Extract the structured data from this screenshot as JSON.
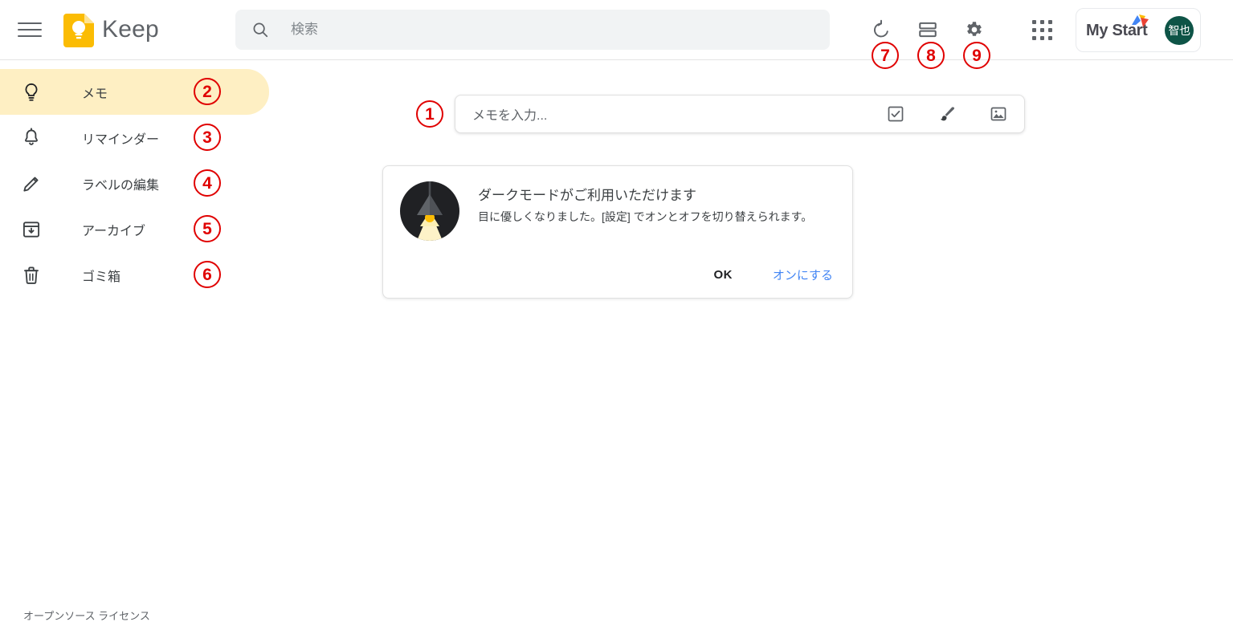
{
  "app": {
    "name": "Keep",
    "logo_icon": "keep-note-bulb-icon",
    "footer_link": "オープンソース ライセンス"
  },
  "header": {
    "menu_icon": "hamburger-menu-icon",
    "search": {
      "icon": "search-icon",
      "placeholder": "検索",
      "value": ""
    },
    "actions": [
      {
        "name": "refresh-button",
        "icon": "refresh-icon",
        "badge": "7"
      },
      {
        "name": "list-view-button",
        "icon": "list-view-icon",
        "badge": "8"
      },
      {
        "name": "settings-button",
        "icon": "gear-icon",
        "badge": "9"
      }
    ],
    "apps_icon": "apps-grid-icon",
    "account": {
      "brand": "My Start",
      "brand_logo_icon": "mystart-triangles-logo",
      "avatar_initials": "智也",
      "avatar_color": "#0e5447"
    }
  },
  "sidebar": {
    "active_color": "#feefc3",
    "items": [
      {
        "label": "メモ",
        "icon": "bulb-icon",
        "badge": "2",
        "active": true
      },
      {
        "label": "リマインダー",
        "icon": "bell-icon",
        "badge": "3",
        "active": false
      },
      {
        "label": "ラベルの編集",
        "icon": "pencil-icon",
        "badge": "4",
        "active": false
      },
      {
        "label": "アーカイブ",
        "icon": "archive-icon",
        "badge": "5",
        "active": false
      },
      {
        "label": "ゴミ箱",
        "icon": "trash-icon",
        "badge": "6",
        "active": false
      }
    ]
  },
  "main": {
    "composer": {
      "placeholder": "メモを入力...",
      "value": "",
      "badge": "1",
      "actions": [
        {
          "name": "new-list-button",
          "icon": "checkbox-icon"
        },
        {
          "name": "new-drawing-button",
          "icon": "brush-icon"
        },
        {
          "name": "new-image-button",
          "icon": "image-icon"
        }
      ]
    },
    "dark_mode_card": {
      "illustration_icon": "lamp-dark-mode-illustration",
      "title": "ダークモードがご利用いただけます",
      "body": "目に優しくなりました。[設定] でオンとオフを切り替えられます。",
      "ok_label": "OK",
      "enable_label": "オンにする",
      "enable_color": "#4285f4"
    }
  }
}
